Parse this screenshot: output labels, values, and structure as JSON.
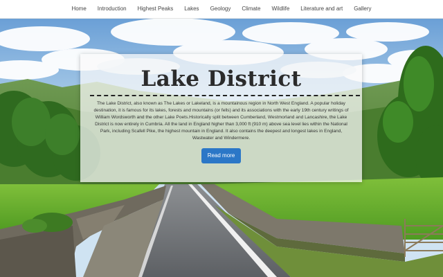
{
  "nav": {
    "items": [
      {
        "label": "Home"
      },
      {
        "label": "Introduction"
      },
      {
        "label": "Highest Peaks"
      },
      {
        "label": "Lakes"
      },
      {
        "label": "Geology"
      },
      {
        "label": "Climate"
      },
      {
        "label": "Wildlife"
      },
      {
        "label": "Literature and art"
      },
      {
        "label": "Gallery"
      }
    ]
  },
  "hero": {
    "title": "Lake District",
    "description": "The Lake District, also known as The Lakes or Lakeland, is a mountainous region in North West England. A popular holiday destination, it is famous for its lakes, forests and mountains (or fells) and its associations with the early 19th century writings of William Wordsworth and the other Lake Poets.Historically split between Cumberland, Westmorland and Lancashire, the Lake District is now entirely in Cumbria. All the land in England higher than 3,000 ft (910 m) above sea level lies within the National Park, including Scafell Pike, the highest mountain in England. It also contains the deepest and longest lakes in England, Wastwater and Windermere.",
    "button_label": "Read more"
  },
  "colors": {
    "accent": "#2b77c7",
    "nav_background": "#ffffff",
    "nav_text": "#444444"
  }
}
